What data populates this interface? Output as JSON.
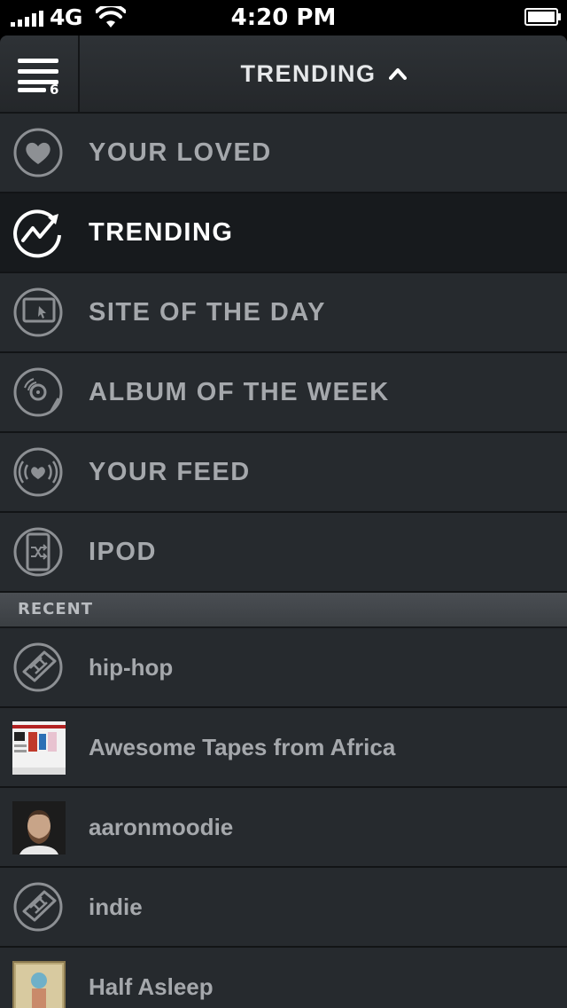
{
  "status_bar": {
    "network": "4G",
    "time": "4:20 PM",
    "icons": [
      "signal-bars-icon",
      "wifi-icon",
      "battery-icon"
    ]
  },
  "header": {
    "menu_badge": "6",
    "title": "TRENDING",
    "icons": [
      "menu-icon",
      "chevron-up-icon"
    ]
  },
  "nav": {
    "items": [
      {
        "label": "YOUR LOVED",
        "icon": "heart-icon",
        "active": false
      },
      {
        "label": "TRENDING",
        "icon": "trending-icon",
        "active": true
      },
      {
        "label": "SITE OF THE DAY",
        "icon": "site-icon",
        "active": false
      },
      {
        "label": "ALBUM OF THE WEEK",
        "icon": "vinyl-record-icon",
        "active": false
      },
      {
        "label": "YOUR FEED",
        "icon": "broadcast-heart-icon",
        "active": false
      },
      {
        "label": "IPOD",
        "icon": "ipod-shuffle-icon",
        "active": false
      }
    ]
  },
  "recent": {
    "heading": "RECENT",
    "items": [
      {
        "label": "hip-hop",
        "icon": "tag-icon"
      },
      {
        "label": "Awesome Tapes from Africa",
        "icon": "site-thumbnail"
      },
      {
        "label": "aaronmoodie",
        "icon": "user-avatar"
      },
      {
        "label": "indie",
        "icon": "tag-icon"
      },
      {
        "label": "Half Asleep",
        "icon": "artist-thumbnail"
      }
    ]
  },
  "colors": {
    "background": "#262a2e",
    "active_background": "#171a1d",
    "label": "#a5a8ac",
    "active_label": "#ffffff",
    "section_header": "#44484d"
  }
}
